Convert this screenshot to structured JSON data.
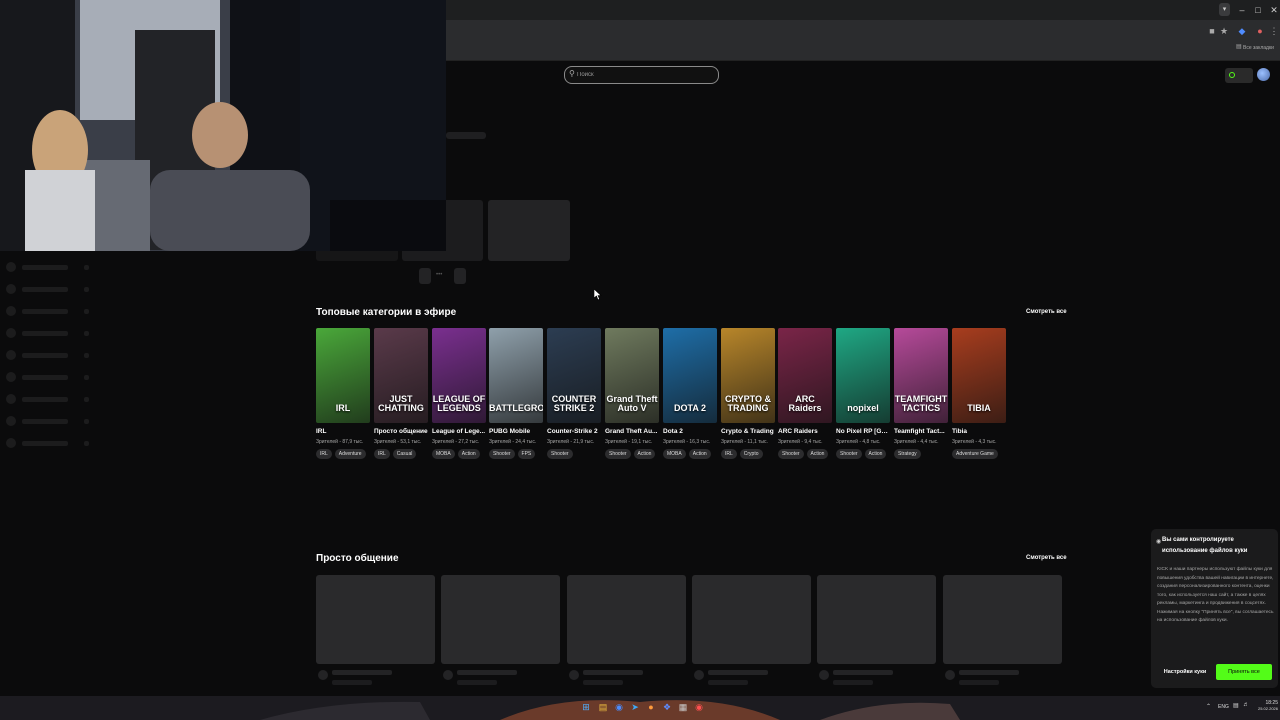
{
  "browser": {
    "bookmarks_label": "Все закладки",
    "window_controls": [
      "minimize-icon",
      "maximize-icon",
      "close-icon"
    ]
  },
  "header": {
    "search_placeholder": "Поиск",
    "live_indicator_color": "#53fc18"
  },
  "top_categories": {
    "title": "Топовые категории в эфире",
    "see_all": "Смотреть все",
    "items": [
      {
        "name": "IRL",
        "viewers": "Зрителей - 87,9 тыс.",
        "tags": [
          "IRL",
          "Adventure"
        ],
        "thumb_text": "IRL",
        "color": "#4aa83a"
      },
      {
        "name": "Просто общение",
        "viewers": "Зрителей - 53,1 тыс.",
        "tags": [
          "IRL",
          "Casual"
        ],
        "thumb_text": "JUST CHATTING",
        "color": "#5a3a4a"
      },
      {
        "name": "League of Lege...",
        "viewers": "Зрителей - 27,2 тыс.",
        "tags": [
          "MOBA",
          "Action"
        ],
        "thumb_text": "LEAGUE OF LEGENDS",
        "color": "#7a2f8f"
      },
      {
        "name": "PUBG Mobile",
        "viewers": "Зрителей - 24,4 тыс.",
        "tags": [
          "Shooter",
          "FPS"
        ],
        "thumb_text": "BATTLEGROUNDS",
        "color": "#8fa0ab"
      },
      {
        "name": "Counter-Strike 2",
        "viewers": "Зрителей - 21,9 тыс.",
        "tags": [
          "Shooter"
        ],
        "thumb_text": "COUNTER STRIKE 2",
        "color": "#2c3d52"
      },
      {
        "name": "Grand Theft Au...",
        "viewers": "Зрителей - 19,1 тыс.",
        "tags": [
          "Shooter",
          "Action"
        ],
        "thumb_text": "Grand Theft Auto V",
        "color": "#6f7a5e"
      },
      {
        "name": "Dota 2",
        "viewers": "Зрителей - 16,3 тыс.",
        "tags": [
          "MOBA",
          "Action"
        ],
        "thumb_text": "DOTA 2",
        "color": "#1e6ea8"
      },
      {
        "name": "Crypto & Trading",
        "viewers": "Зрителей - 11,1 тыс.",
        "tags": [
          "IRL",
          "Crypto"
        ],
        "thumb_text": "CRYPTO & TRADING",
        "color": "#b8862a"
      },
      {
        "name": "ARC Raiders",
        "viewers": "Зрителей - 9,4 тыс.",
        "tags": [
          "Shooter",
          "Action"
        ],
        "thumb_text": "ARC Raiders",
        "color": "#7a2548"
      },
      {
        "name": "No Pixel RP [GT...",
        "viewers": "Зрителей - 4,8 тыс.",
        "tags": [
          "Shooter",
          "Action"
        ],
        "thumb_text": "nopixel",
        "color": "#1fa884"
      },
      {
        "name": "Teamfight Tact...",
        "viewers": "Зрителей - 4,4 тыс.",
        "tags": [
          "Strategy"
        ],
        "thumb_text": "TEAMFIGHT TACTICS",
        "color": "#b64a9a"
      },
      {
        "name": "Tibia",
        "viewers": "Зрителей - 4,3 тыс.",
        "tags": [
          "Adventure Game"
        ],
        "thumb_text": "TIBIA",
        "color": "#a83d1e"
      }
    ]
  },
  "just_chatting": {
    "title": "Просто общение",
    "see_all": "Смотреть все"
  },
  "cookie_banner": {
    "title": "Вы сами контролируете использование файлов куки",
    "text": "KICK и наши партнеры используют файлы куки для повышения удобства вашей навигации в интернете, создания персонализированного контента, оценки того, как используется наш сайт, а также в целях рекламы, маркетинга и продвижения в соцсетях. Нажимая на кнопку \"Принять все\", вы соглашаетесь на использование файлов куки.",
    "settings_label": "Настройки куки",
    "accept_label": "Принять все",
    "accent": "#53fc18"
  },
  "taskbar": {
    "language": "ENG",
    "time": "18:25",
    "date": "25.02.2026"
  }
}
